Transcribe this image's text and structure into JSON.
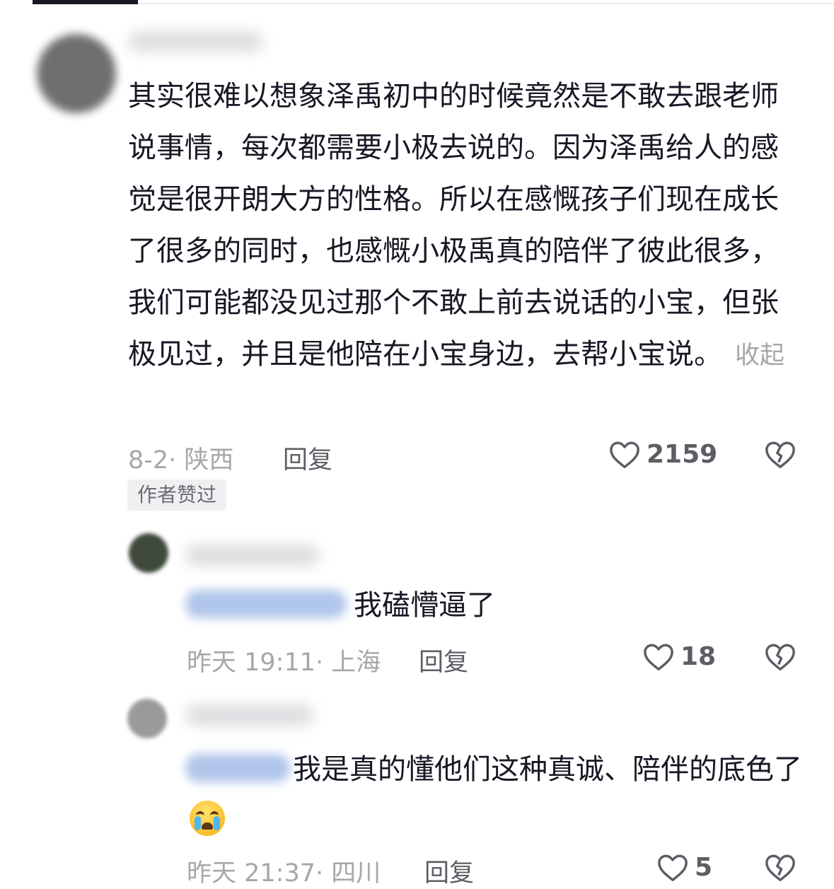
{
  "comment1": {
    "text": "其实很难以想象泽禹初中的时候竟然是不敢去跟老师说事情，每次都需要小极去说的。因为泽禹给人的感觉是很开朗大方的性格。所以在感慨孩子们现在成长了很多的同时，也感慨小极禹真的陪伴了彼此很多，我们可能都没见过那个不敢上前去说话的小宝，但张极见过，并且是他陪在小宝身边，去帮小宝说。",
    "collapse_label": "收起",
    "date": "8-2· 陕西",
    "reply_label": "回复",
    "likes": "2159",
    "badge": "作者赞过"
  },
  "reply1": {
    "text": "我磕懵逼了",
    "date": "昨天 19:11· 上海",
    "reply_label": "回复",
    "likes": "18"
  },
  "reply2": {
    "text": "我是真的懂他们这种真诚、陪伴的底色了",
    "emoji": "loudly-crying-face",
    "date": "昨天 21:37· 四川",
    "reply_label": "回复",
    "likes": "5"
  }
}
